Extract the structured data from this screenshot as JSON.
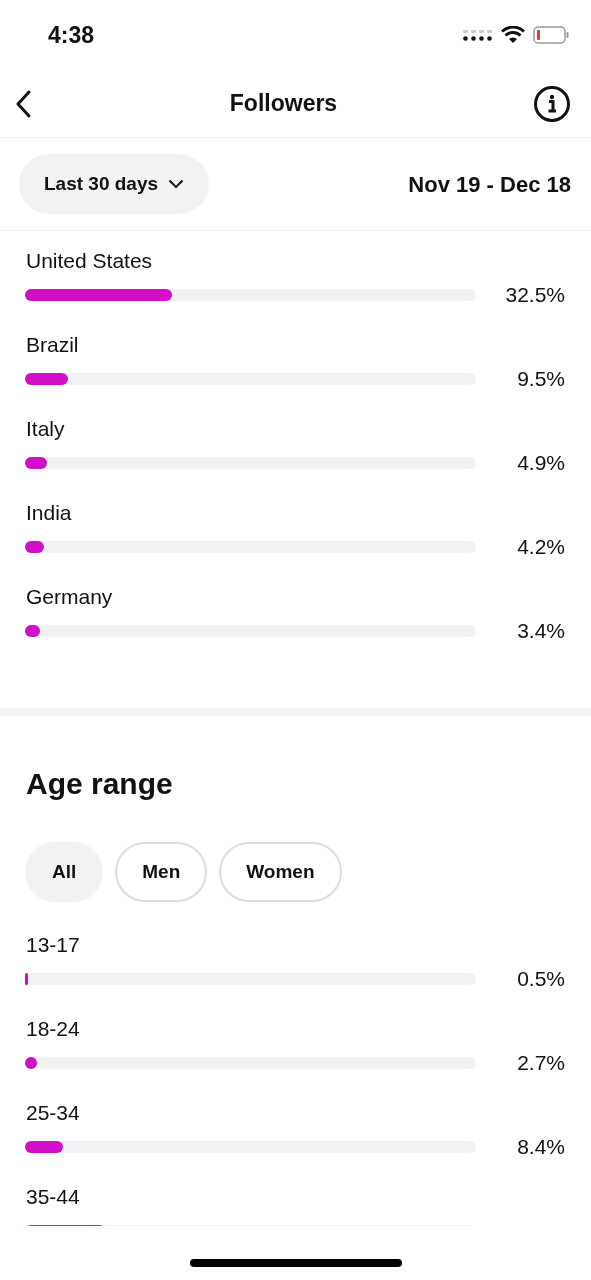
{
  "status_bar": {
    "time": "4:38"
  },
  "nav": {
    "title": "Followers"
  },
  "filter": {
    "period": "Last 30 days",
    "date_range": "Nov 19 - Dec 18"
  },
  "countries": [
    {
      "name": "United States",
      "level": 0.325,
      "reading": "32.5%"
    },
    {
      "name": "Brazil",
      "level": 0.095,
      "reading": "9.5%"
    },
    {
      "name": "Italy",
      "level": 0.049,
      "reading": "4.9%"
    },
    {
      "name": "India",
      "level": 0.042,
      "reading": "4.2%"
    },
    {
      "name": "Germany",
      "level": 0.034,
      "reading": "3.4%"
    }
  ],
  "age_range": {
    "title": "Age range",
    "filters": [
      {
        "label": "All",
        "selected": true
      },
      {
        "label": "Men",
        "selected": false
      },
      {
        "label": "Women",
        "selected": false
      }
    ],
    "rows": [
      {
        "name": "13-17",
        "level": 0.005,
        "reading": "0.5%"
      },
      {
        "name": "18-24",
        "level": 0.027,
        "reading": "2.7%"
      },
      {
        "name": "25-34",
        "level": 0.084,
        "reading": "8.4%"
      },
      {
        "name": "35-44",
        "level": 0.177
      }
    ]
  }
}
